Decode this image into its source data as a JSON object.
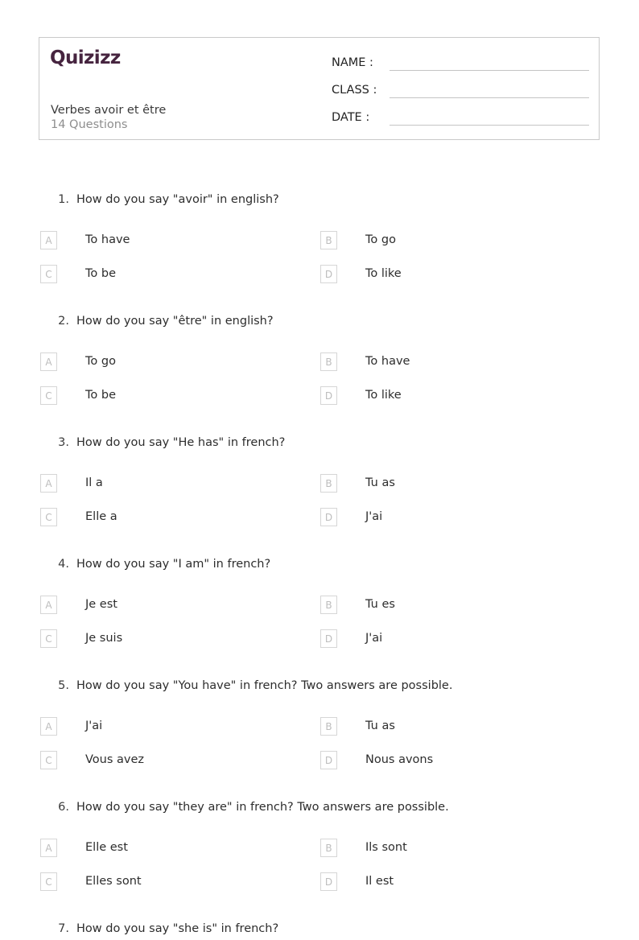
{
  "header": {
    "logo_text": "Quizizz",
    "quiz_title": "Verbes avoir et être",
    "question_count": "14 Questions",
    "fields": [
      {
        "label": "NAME :",
        "value": ""
      },
      {
        "label": "CLASS :",
        "value": ""
      },
      {
        "label": "DATE  :",
        "value": ""
      }
    ]
  },
  "colors": {
    "logo": "#46243f",
    "card_border": "#c9c9c9",
    "field_line": "#c4c4c4",
    "letter_box_border": "#d6d6d6",
    "letter_text": "#bdbdbd",
    "question_text": "#2d2d2d",
    "muted_text": "#8e8e8e"
  },
  "questions": [
    {
      "number": "1.",
      "text": "How do you say \"avoir\" in english?",
      "options": [
        {
          "letter": "A",
          "text": "To have"
        },
        {
          "letter": "B",
          "text": "To go"
        },
        {
          "letter": "C",
          "text": "To be"
        },
        {
          "letter": "D",
          "text": "To like"
        }
      ]
    },
    {
      "number": "2.",
      "text": "How do you say \"être\" in english?",
      "options": [
        {
          "letter": "A",
          "text": "To go"
        },
        {
          "letter": "B",
          "text": "To have"
        },
        {
          "letter": "C",
          "text": "To be"
        },
        {
          "letter": "D",
          "text": "To like"
        }
      ]
    },
    {
      "number": "3.",
      "text": "How do you say \"He has\" in french?",
      "options": [
        {
          "letter": "A",
          "text": "Il a"
        },
        {
          "letter": "B",
          "text": "Tu as"
        },
        {
          "letter": "C",
          "text": "Elle a"
        },
        {
          "letter": "D",
          "text": "J'ai"
        }
      ]
    },
    {
      "number": "4.",
      "text": "How do you say \"I am\" in french?",
      "options": [
        {
          "letter": "A",
          "text": "Je est"
        },
        {
          "letter": "B",
          "text": "Tu es"
        },
        {
          "letter": "C",
          "text": "Je suis"
        },
        {
          "letter": "D",
          "text": "J'ai"
        }
      ]
    },
    {
      "number": "5.",
      "text": "How do you say \"You have\" in french? Two answers are possible.",
      "options": [
        {
          "letter": "A",
          "text": "J'ai"
        },
        {
          "letter": "B",
          "text": "Tu as"
        },
        {
          "letter": "C",
          "text": "Vous avez"
        },
        {
          "letter": "D",
          "text": "Nous avons"
        }
      ]
    },
    {
      "number": "6.",
      "text": "How do you say \"they are\" in french? Two answers are possible.",
      "options": [
        {
          "letter": "A",
          "text": "Elle est"
        },
        {
          "letter": "B",
          "text": "Ils sont"
        },
        {
          "letter": "C",
          "text": "Elles sont"
        },
        {
          "letter": "D",
          "text": "Il est"
        }
      ]
    },
    {
      "number": "7.",
      "text": "How do you say \"she is\" in french?",
      "options": []
    }
  ]
}
